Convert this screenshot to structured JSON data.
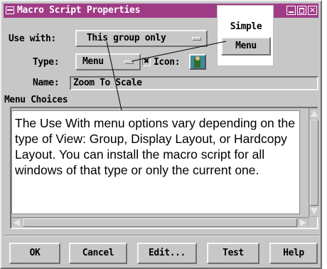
{
  "window": {
    "title": "Macro Script Properties",
    "title_bar_color": "#a03c86",
    "close_glyph": "✕"
  },
  "form": {
    "use_with_label": "Use with:",
    "use_with_value": "This group only",
    "type_label": "Type:",
    "type_value": "Menu",
    "icon_checkbox_mark": "✖",
    "icon_label": "Icon:",
    "icon_checked": true,
    "name_label": "Name:",
    "name_value": "Zoom To Scale",
    "menu_choices_label": "Menu Choices"
  },
  "type_dropdown": {
    "options": [
      "Simple",
      "Menu"
    ],
    "selected": "Menu"
  },
  "annotation": {
    "text": "The Use With menu options vary depending on the type of View: Group, Display Layout, or Hardcopy Layout.  You can install the macro script for all windows of that type or only the current one."
  },
  "buttons": {
    "ok": "OK",
    "cancel": "Cancel",
    "edit": "Edit...",
    "test": "Test",
    "help": "Help"
  }
}
